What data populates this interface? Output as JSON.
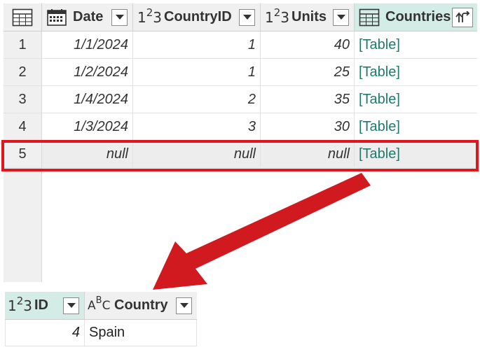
{
  "main_table": {
    "columns": [
      {
        "label": "Date",
        "type_icon": "calendar-icon"
      },
      {
        "label": "CountryID",
        "type_icon": "123",
        "type_text": [
          "1",
          "2",
          "3"
        ]
      },
      {
        "label": "Units",
        "type_icon": "123",
        "type_text": [
          "1",
          "2",
          "3"
        ]
      },
      {
        "label": "Countries",
        "type_icon": "table-icon"
      }
    ],
    "rows": [
      {
        "num": "1",
        "date": "1/1/2024",
        "country_id": "1",
        "units": "40",
        "countries": "[Table]"
      },
      {
        "num": "2",
        "date": "1/2/2024",
        "country_id": "1",
        "units": "25",
        "countries": "[Table]"
      },
      {
        "num": "3",
        "date": "1/4/2024",
        "country_id": "2",
        "units": "35",
        "countries": "[Table]"
      },
      {
        "num": "4",
        "date": "1/3/2024",
        "country_id": "3",
        "units": "30",
        "countries": "[Table]"
      },
      {
        "num": "5",
        "date": "null",
        "country_id": "null",
        "units": "null",
        "countries": "[Table]"
      }
    ],
    "selected_row": "5"
  },
  "sub_table": {
    "columns": [
      {
        "label": "ID",
        "type_text": [
          "1",
          "2",
          "3"
        ]
      },
      {
        "label": "Country",
        "type_text": [
          "A",
          "B",
          "C"
        ]
      }
    ],
    "rows": [
      {
        "id": "4",
        "country": "Spain"
      }
    ]
  },
  "colors": {
    "highlight": "#e0151d",
    "arrow": "#d01a1f",
    "table_link": "#1f7a6b",
    "active_header": "#d4ece6"
  }
}
